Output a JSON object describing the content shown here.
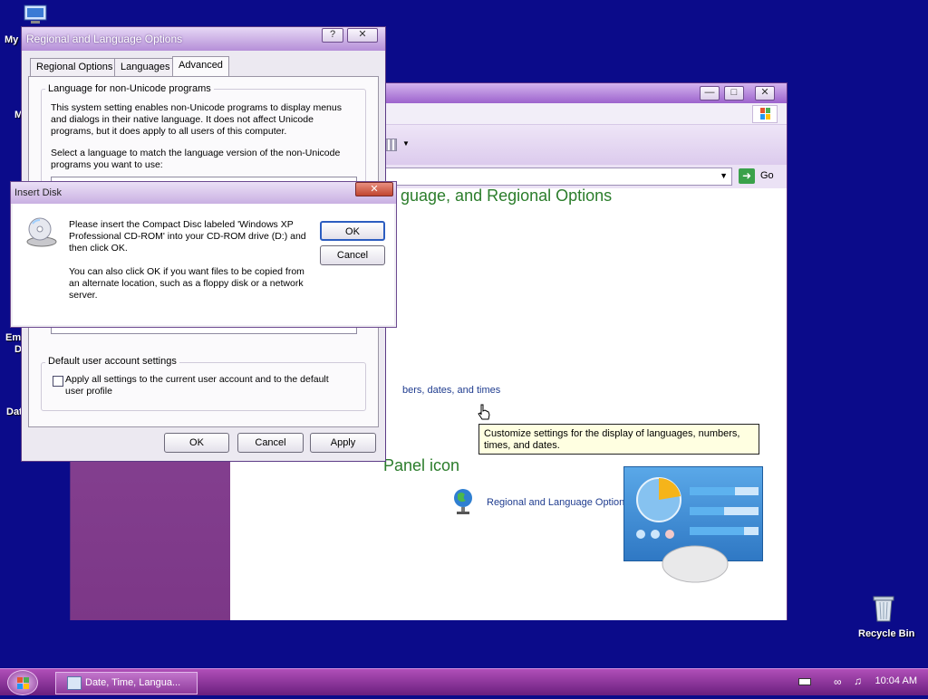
{
  "desktop": {
    "icons": [
      {
        "label": "My"
      },
      {
        "label": "M"
      },
      {
        "label": "Em"
      },
      {
        "label": "D"
      },
      {
        "label": "Dat"
      },
      {
        "label": "Recycle Bin"
      }
    ]
  },
  "control_panel": {
    "heading_1": "guage, and Regional Options",
    "link_partial": "bers, dates, and times",
    "heading_2": "Panel icon",
    "icon_link": "Regional and Language Options",
    "address_go": "Go"
  },
  "regional_dialog": {
    "title": "Regional and Language Options",
    "tabs": [
      "Regional Options",
      "Languages",
      "Advanced"
    ],
    "active_tab": "Advanced",
    "group1_title": "Language for non-Unicode programs",
    "group1_text": "This system setting enables non-Unicode programs to display menus and dialogs in their native language. It does not affect Unicode programs, but it does apply to all users of this computer.",
    "group1_select_text": "Select a language to match the language version of the non-Unicode programs you want to use:",
    "group2_title": "Default user account settings",
    "checkbox_label": "Apply all settings to the current user account and to the default user profile",
    "buttons": {
      "ok": "OK",
      "cancel": "Cancel",
      "apply": "Apply"
    }
  },
  "disk_dialog": {
    "title": "Insert Disk",
    "message_1": "Please insert the Compact Disc labeled 'Windows XP Professional CD-ROM' into your CD-ROM drive (D:) and then click OK.",
    "message_2": "You can also click OK if you want files to be copied from an alternate location, such as a floppy disk or a network server.",
    "buttons": {
      "ok": "OK",
      "cancel": "Cancel"
    }
  },
  "tooltip": {
    "text": "Customize settings for the display of languages, numbers, times, and dates."
  },
  "taskbar": {
    "task_label": "Date, Time, Langua...",
    "clock": "10:04 AM"
  }
}
